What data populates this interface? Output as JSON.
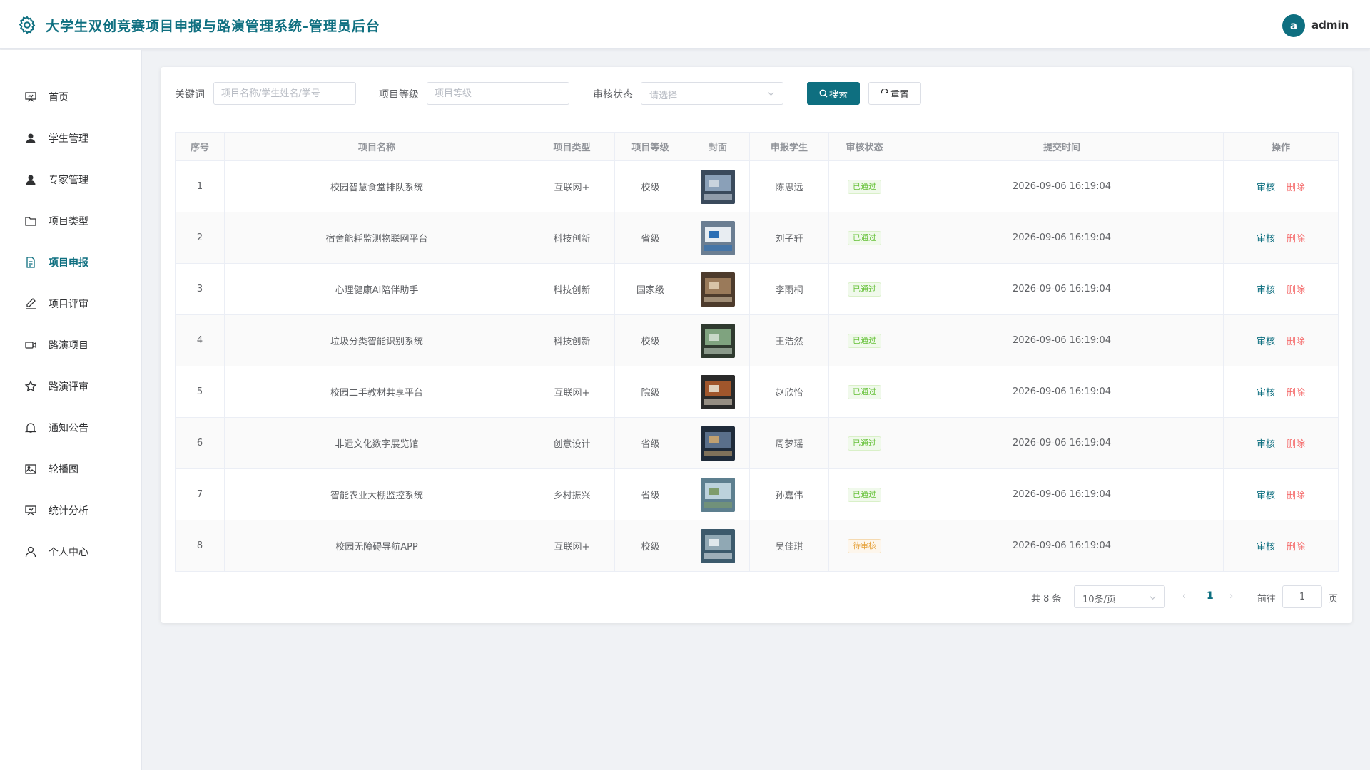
{
  "header": {
    "title": "大学生双创竞赛项目申报与路演管理系统-管理员后台",
    "avatar_letter": "a",
    "username": "admin"
  },
  "sidebar": {
    "items": [
      {
        "label": "首页",
        "icon": "home-icon",
        "active": false
      },
      {
        "label": "学生管理",
        "icon": "user-icon",
        "active": false
      },
      {
        "label": "专家管理",
        "icon": "user-icon",
        "active": false
      },
      {
        "label": "项目类型",
        "icon": "folder-icon",
        "active": false
      },
      {
        "label": "项目申报",
        "icon": "document-icon",
        "active": true
      },
      {
        "label": "项目评审",
        "icon": "edit-icon",
        "active": false
      },
      {
        "label": "路演项目",
        "icon": "video-icon",
        "active": false
      },
      {
        "label": "路演评审",
        "icon": "star-icon",
        "active": false
      },
      {
        "label": "通知公告",
        "icon": "bell-icon",
        "active": false
      },
      {
        "label": "轮播图",
        "icon": "picture-icon",
        "active": false
      },
      {
        "label": "统计分析",
        "icon": "chart-icon",
        "active": false
      },
      {
        "label": "个人中心",
        "icon": "person-icon",
        "active": false
      }
    ]
  },
  "filters": {
    "keyword_label": "关键词",
    "keyword_placeholder": "项目名称/学生姓名/学号",
    "level_label": "项目等级",
    "level_placeholder": "项目等级",
    "status_label": "审核状态",
    "status_placeholder": "请选择",
    "search_button": "搜索",
    "reset_button": "重置"
  },
  "table": {
    "headers": [
      "序号",
      "项目名称",
      "项目类型",
      "项目等级",
      "封面",
      "申报学生",
      "审核状态",
      "提交时间",
      "操作"
    ],
    "audit_label": "审核",
    "delete_label": "删除",
    "rows": [
      {
        "index": "1",
        "name": "校园智慧食堂排队系统",
        "type": "互联网+",
        "level": "校级",
        "student": "陈思远",
        "status": "已通过",
        "status_kind": "pass",
        "time": "2026-09-06 16:19:04"
      },
      {
        "index": "2",
        "name": "宿舍能耗监测物联网平台",
        "type": "科技创新",
        "level": "省级",
        "student": "刘子轩",
        "status": "已通过",
        "status_kind": "pass",
        "time": "2026-09-06 16:19:04"
      },
      {
        "index": "3",
        "name": "心理健康AI陪伴助手",
        "type": "科技创新",
        "level": "国家级",
        "student": "李雨桐",
        "status": "已通过",
        "status_kind": "pass",
        "time": "2026-09-06 16:19:04"
      },
      {
        "index": "4",
        "name": "垃圾分类智能识别系统",
        "type": "科技创新",
        "level": "校级",
        "student": "王浩然",
        "status": "已通过",
        "status_kind": "pass",
        "time": "2026-09-06 16:19:04"
      },
      {
        "index": "5",
        "name": "校园二手教材共享平台",
        "type": "互联网+",
        "level": "院级",
        "student": "赵欣怡",
        "status": "已通过",
        "status_kind": "pass",
        "time": "2026-09-06 16:19:04"
      },
      {
        "index": "6",
        "name": "非遗文化数字展览馆",
        "type": "创意设计",
        "level": "省级",
        "student": "周梦瑶",
        "status": "已通过",
        "status_kind": "pass",
        "time": "2026-09-06 16:19:04"
      },
      {
        "index": "7",
        "name": "智能农业大棚监控系统",
        "type": "乡村振兴",
        "level": "省级",
        "student": "孙嘉伟",
        "status": "已通过",
        "status_kind": "pass",
        "time": "2026-09-06 16:19:04"
      },
      {
        "index": "8",
        "name": "校园无障碍导航APP",
        "type": "互联网+",
        "level": "校级",
        "student": "吴佳琪",
        "status": "待审核",
        "status_kind": "pending",
        "time": "2026-09-06 16:19:04"
      }
    ]
  },
  "pagination": {
    "total_text": "共 8 条",
    "page_size": "10条/页",
    "current_page": "1",
    "goto_label": "前往",
    "goto_value": "1",
    "page_suffix": "页"
  },
  "colors": {
    "primary": "#0e6f80",
    "pass": "#67c23a",
    "pending": "#e6a23c",
    "danger": "#f56c6c"
  }
}
